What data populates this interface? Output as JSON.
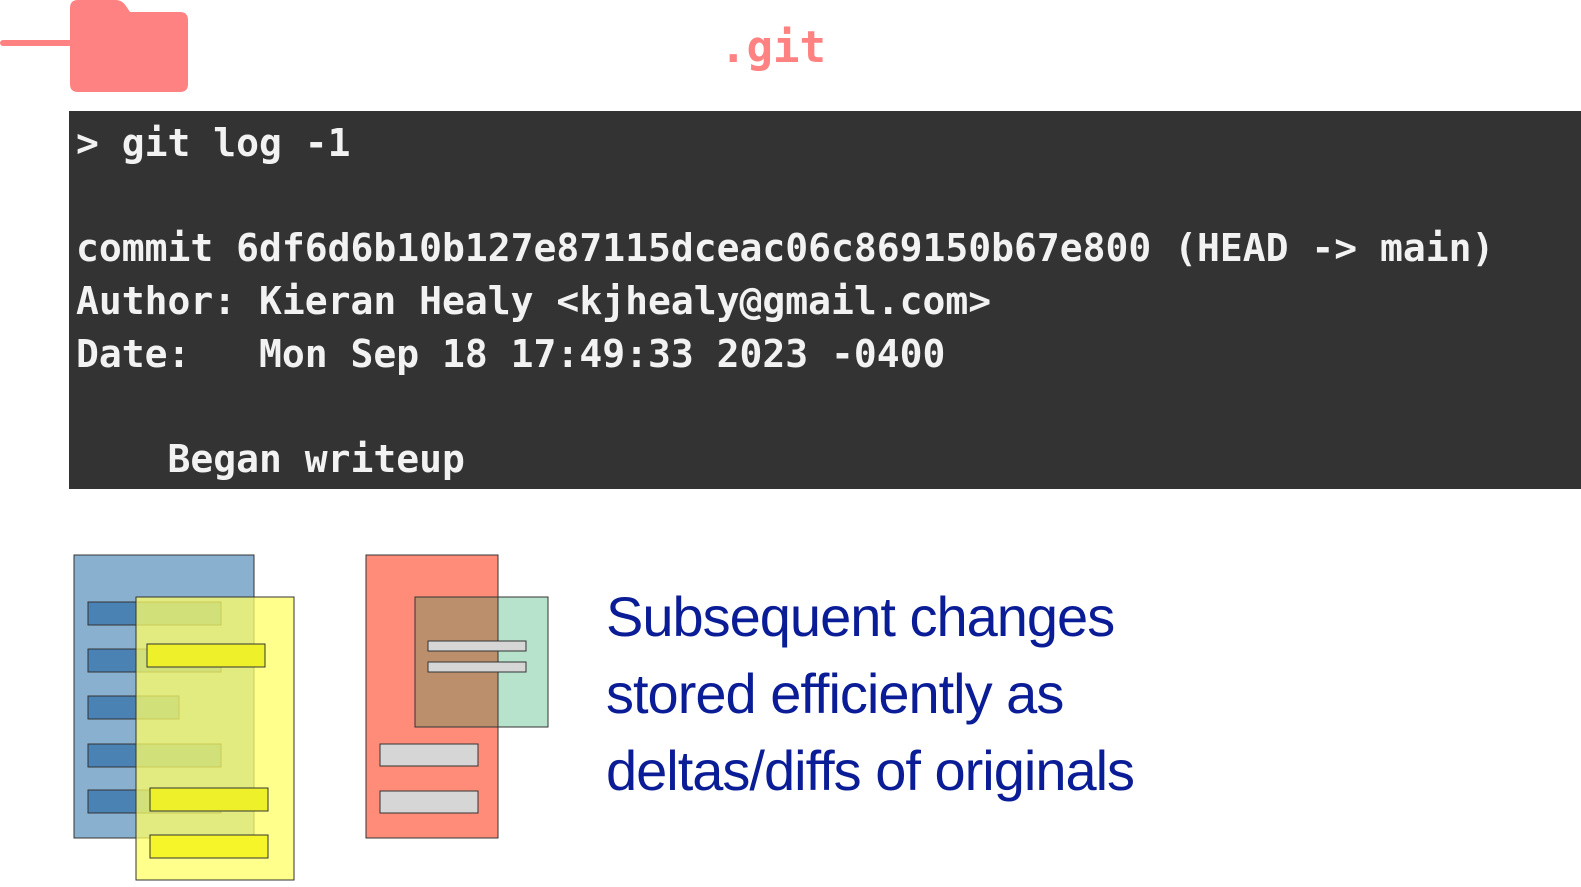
{
  "folder": {
    "icon": "folder-icon",
    "label": ".git",
    "color": "#ff8282"
  },
  "terminal": {
    "background": "#333333",
    "text_color": "#f2f2f2",
    "prompt": "> git log -1",
    "commit_line": "commit 6df6d6b10b127e87115dceac06c869150b67e800 (HEAD -> main)",
    "author_line": "Author: Kieran Healy <kjhealy@gmail.com>",
    "date_line": "Date:   Mon Sep 18 17:49:33 2023 -0400",
    "message_line": "    Began writeup"
  },
  "diagram": {
    "original_file_colors": {
      "page": "#8ab0cf",
      "line": "#4a82b4"
    },
    "changed_file_colors": {
      "page": "#ffff66",
      "line": "#eef12a"
    },
    "delta_file_colors": {
      "page": "#ff8c78",
      "overlay": "#b7e2cc",
      "line": "#d6d6d6"
    }
  },
  "caption": {
    "lines": [
      "Subsequent changes",
      "stored efficiently as",
      "deltas/diffs of originals"
    ],
    "color": "#0a1c96"
  }
}
